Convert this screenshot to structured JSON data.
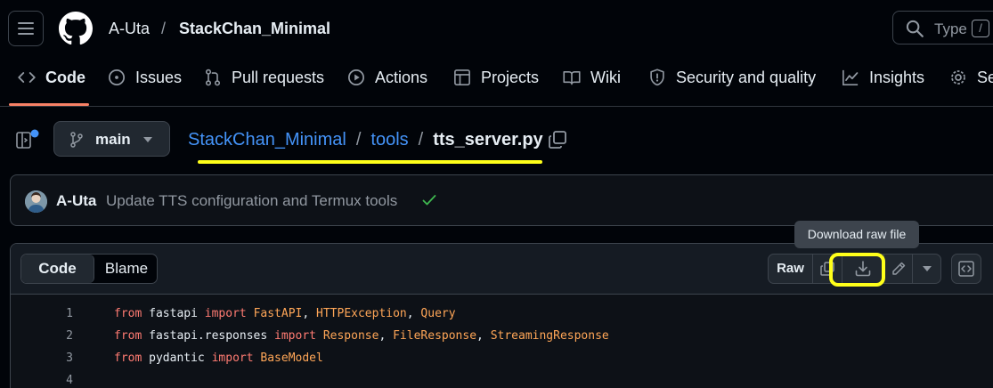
{
  "header": {
    "owner": "A-Uta",
    "separator": "/",
    "repo": "StackChan_Minimal",
    "search_placeholder": "Type",
    "search_kbd": "/"
  },
  "tabs": [
    {
      "label": "Code",
      "icon": "code-icon",
      "active": true
    },
    {
      "label": "Issues",
      "icon": "issue-opened-icon"
    },
    {
      "label": "Pull requests",
      "icon": "git-pull-request-icon"
    },
    {
      "label": "Actions",
      "icon": "play-icon"
    },
    {
      "label": "Projects",
      "icon": "table-icon"
    },
    {
      "label": "Wiki",
      "icon": "book-icon"
    },
    {
      "label": "Security and quality",
      "icon": "shield-icon"
    },
    {
      "label": "Insights",
      "icon": "graph-icon"
    },
    {
      "label": "Se",
      "icon": "gear-icon"
    }
  ],
  "branch": {
    "label": "main"
  },
  "breadcrumb": {
    "repo": "StackChan_Minimal",
    "folder": "tools",
    "file": "tts_server.py",
    "sep": "/"
  },
  "commit": {
    "author": "A-Uta",
    "message": "Update TTS configuration and Termux tools"
  },
  "file_header": {
    "code_tab": "Code",
    "blame_tab": "Blame",
    "raw_label": "Raw",
    "tooltip": "Download raw file"
  },
  "code": [
    {
      "num": "1",
      "tokens": [
        {
          "t": "from",
          "c": "kw"
        },
        {
          "t": " fastapi ",
          "c": ""
        },
        {
          "t": "import",
          "c": "kw"
        },
        {
          "t": " ",
          "c": ""
        },
        {
          "t": "FastAPI",
          "c": "cl"
        },
        {
          "t": ", ",
          "c": ""
        },
        {
          "t": "HTTPException",
          "c": "cl"
        },
        {
          "t": ", ",
          "c": ""
        },
        {
          "t": "Query",
          "c": "cl"
        }
      ]
    },
    {
      "num": "2",
      "tokens": [
        {
          "t": "from",
          "c": "kw"
        },
        {
          "t": " fastapi.responses ",
          "c": ""
        },
        {
          "t": "import",
          "c": "kw"
        },
        {
          "t": " ",
          "c": ""
        },
        {
          "t": "Response",
          "c": "cl"
        },
        {
          "t": ", ",
          "c": ""
        },
        {
          "t": "FileResponse",
          "c": "cl"
        },
        {
          "t": ", ",
          "c": ""
        },
        {
          "t": "StreamingResponse",
          "c": "cl"
        }
      ]
    },
    {
      "num": "3",
      "tokens": [
        {
          "t": "from",
          "c": "kw"
        },
        {
          "t": " pydantic ",
          "c": ""
        },
        {
          "t": "import",
          "c": "kw"
        },
        {
          "t": " ",
          "c": ""
        },
        {
          "t": "BaseModel",
          "c": "cl"
        }
      ]
    },
    {
      "num": "4",
      "tokens": []
    }
  ],
  "colors": {
    "accent_link": "#4493f8",
    "tab_underline": "#f78166",
    "highlight": "#ffff1a",
    "success": "#3fb950"
  }
}
